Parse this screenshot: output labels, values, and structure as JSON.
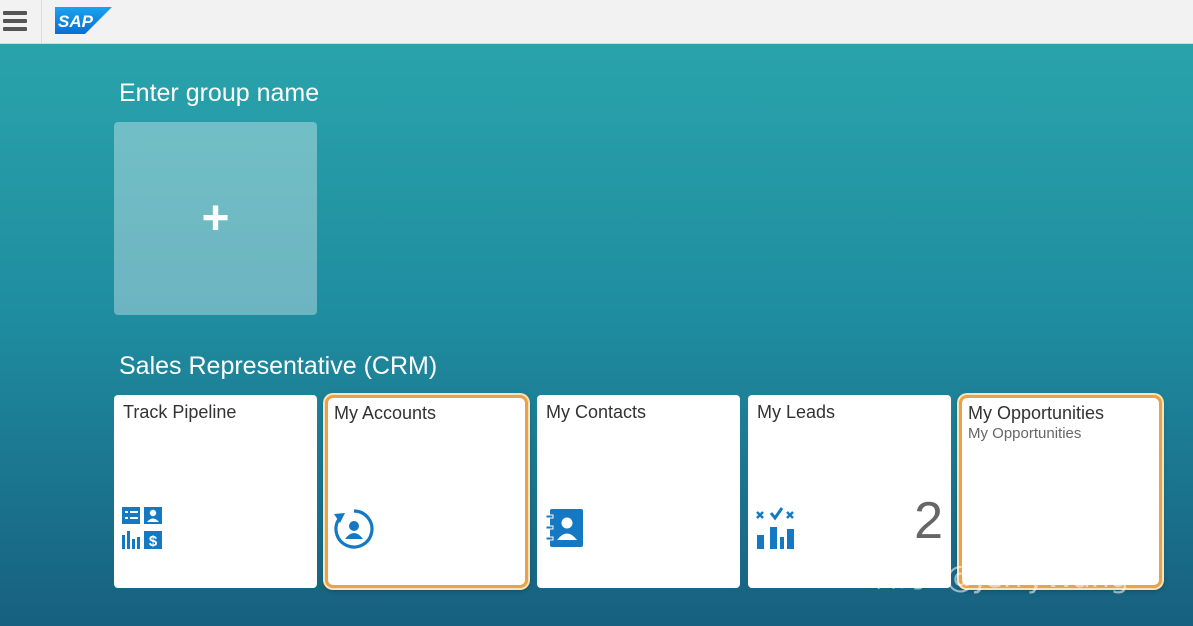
{
  "shell": {
    "logo_text": "SAP"
  },
  "groups": {
    "new_group": {
      "title": "Enter group name",
      "add_symbol": "+"
    },
    "crm": {
      "title": "Sales Representative (CRM)",
      "tiles": [
        {
          "title": "Track Pipeline",
          "icon": "pipeline-icon"
        },
        {
          "title": "My Accounts",
          "icon": "account-sync-icon",
          "highlighted": true
        },
        {
          "title": "My Contacts",
          "icon": "address-book-icon"
        },
        {
          "title": "My Leads",
          "icon": "leads-chart-icon",
          "number": "2"
        },
        {
          "title": "My Opportunities",
          "subtitle": "My Opportunities",
          "highlighted": true
        }
      ]
    }
  },
  "watermark": "知乎 @JerryWang",
  "colors": {
    "icon_blue": "#1479c2",
    "highlight_border": "#e9a14a"
  }
}
